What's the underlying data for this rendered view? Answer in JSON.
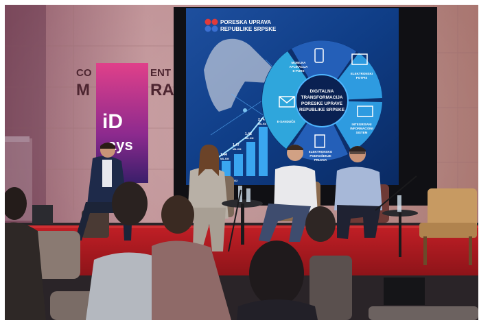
{
  "photo": {
    "screen": {
      "logo_line1": "PORESKA UPRAVA",
      "logo_line2": "REPUBLIKE SRPSKE",
      "center_line1": "DIGITALNA",
      "center_line2": "TRANSFORMACIJA",
      "center_line3": "PORESKE UPRAVE",
      "center_line4": "REPUBLIKE SRPSKE",
      "segments": [
        {
          "line1": "MOBILNA",
          "line2": "APLIKACIJA",
          "line3": "E-PURS",
          "icon": "phone-icon"
        },
        {
          "line1": "ELEKTRONSKI",
          "line2": "POTPIS",
          "line3": "",
          "icon": "monitor-sign-icon"
        },
        {
          "line1": "INTEGRISANI",
          "line2": "INFORMACIONI",
          "line3": "SISTEM",
          "icon": "monitor-icon"
        },
        {
          "line1": "ELEKTRONSKO",
          "line2": "PODNOŠENJE",
          "line3": "PRIJAVA",
          "icon": "document-icon"
        },
        {
          "line1": "E-SANDUČE",
          "line2": "",
          "line3": "",
          "icon": "envelope-icon"
        }
      ],
      "bar_labels": [
        {
          "value": "1,44",
          "unit": "MIL.KM"
        },
        {
          "value": "1,47",
          "unit": "MIL.KM"
        },
        {
          "value": "1,48",
          "unit": "MIL.KM"
        },
        {
          "value": "2,74",
          "unit": "MIL.KM"
        }
      ],
      "bar_axis": "2018 ... 2022"
    },
    "banner": {
      "line1": "iD",
      "line2": "ays"
    },
    "wall_sign": {
      "line1": "CO",
      "line1_end": "ENT",
      "line2": "M",
      "line2_end": "RA"
    },
    "colors": {
      "stage": "#c8202a",
      "screen_bg": "#0b2f73",
      "banner": "#d63a8c",
      "wall": "#b9868c"
    }
  }
}
